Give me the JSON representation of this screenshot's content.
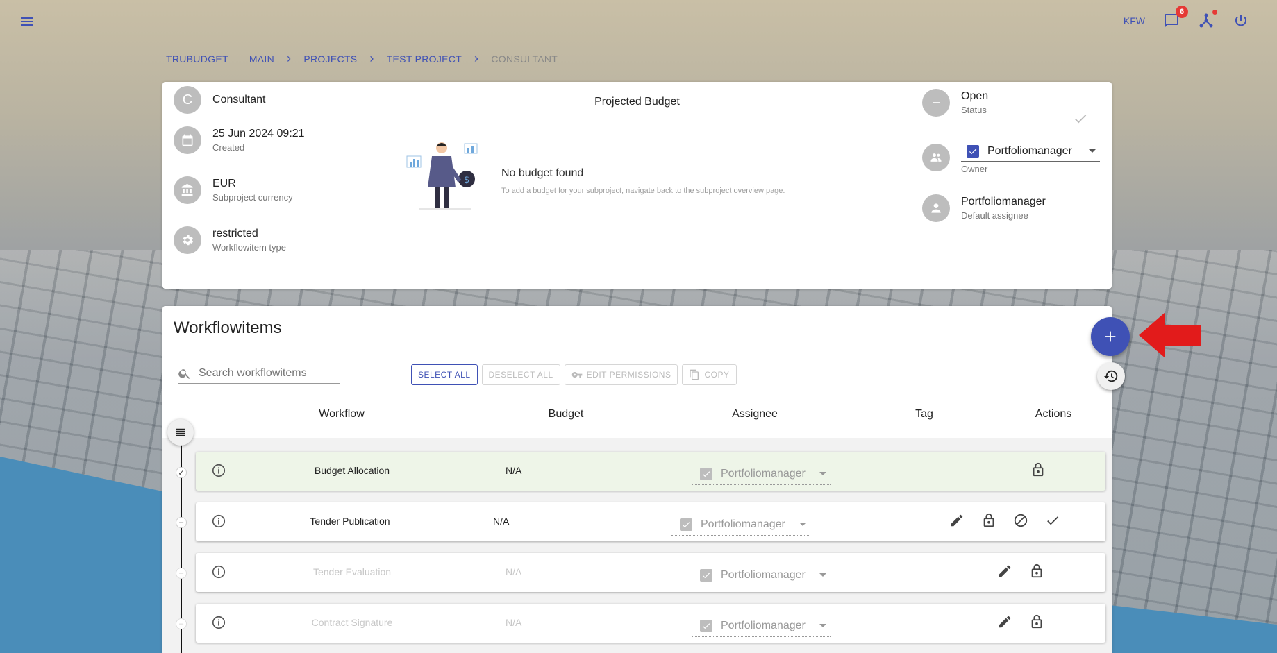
{
  "topbar": {
    "org": "KFW",
    "notification_count": "6",
    "icons": [
      "menu-icon",
      "chat-icon",
      "network-icon",
      "power-icon"
    ]
  },
  "breadcrumb": [
    "TRUBUDGET",
    "MAIN",
    "PROJECTS",
    "TEST PROJECT",
    "CONSULTANT"
  ],
  "details": {
    "avatar_letter": "C",
    "name": "Consultant",
    "created_value": "25 Jun 2024 09:21",
    "created_label": "Created",
    "currency_value": "EUR",
    "currency_label": "Subproject currency",
    "type_value": "restricted",
    "type_label": "Workflowitem type",
    "budget_title": "Projected Budget",
    "no_budget": "No budget found",
    "no_budget_hint": "To add a budget for your subproject, navigate back to the subproject overview page.",
    "status_value": "Open",
    "status_label": "Status",
    "owner_value": "Portfoliomanager",
    "owner_label": "Owner",
    "assignee_value": "Portfoliomanager",
    "assignee_label": "Default assignee"
  },
  "workflow": {
    "title": "Workflowitems",
    "search_placeholder": "Search workflowitems",
    "buttons": {
      "select_all": "SELECT ALL",
      "deselect_all": "DESELECT ALL",
      "edit_permissions": "EDIT PERMISSIONS",
      "copy": "COPY"
    },
    "headers": {
      "workflow": "Workflow",
      "budget": "Budget",
      "assignee": "Assignee",
      "tag": "Tag",
      "actions": "Actions"
    },
    "items": [
      {
        "name": "Budget Allocation",
        "budget": "N/A",
        "assignee": "Portfoliomanager",
        "status": "closed"
      },
      {
        "name": "Tender Publication",
        "budget": "N/A",
        "assignee": "Portfoliomanager",
        "status": "open"
      },
      {
        "name": "Tender Evaluation",
        "budget": "N/A",
        "assignee": "Portfoliomanager",
        "status": "pending"
      },
      {
        "name": "Contract Signature",
        "budget": "N/A",
        "assignee": "Portfoliomanager",
        "status": "pending"
      }
    ]
  },
  "colors": {
    "primary": "#3f51b5",
    "badge": "#e53935",
    "done_row": "#eef5e8",
    "arrow": "#e21b1b"
  }
}
